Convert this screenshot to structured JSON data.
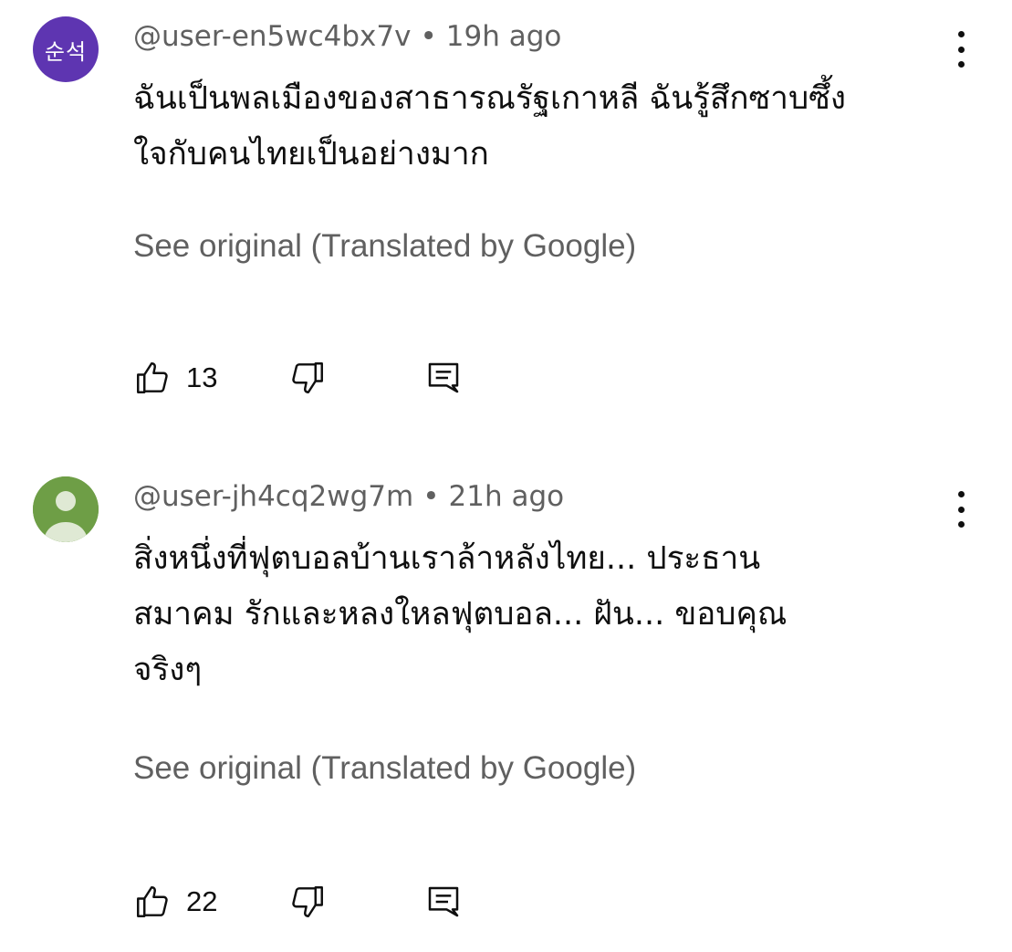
{
  "comments": [
    {
      "avatar_text": "순석",
      "avatar_color": "#5e35b1",
      "handle": "@user-en5wc4bx7v",
      "separator": "•",
      "time": "19h ago",
      "text_lines": [
        "ฉันเป็นพลเมืองของสาธารณรัฐเกาหลี ฉันรู้สึกซาบซึ้ง",
        "ใจกับคนไทยเป็นอย่างมาก"
      ],
      "see_original": "See original (Translated by Google)",
      "likes": "13",
      "icons": [
        "thumbs-up-icon",
        "thumbs-down-icon",
        "reply-icon",
        "more-vert-icon"
      ]
    },
    {
      "avatar_text": "",
      "avatar_color": "#6e9e46",
      "handle": "@user-jh4cq2wg7m",
      "separator": "•",
      "time": "21h ago",
      "text_lines": [
        "สิ่งหนึ่งที่ฟุตบอลบ้านเราล้าหลังไทย... ประธาน",
        "สมาคม รักและหลงใหลฟุตบอล... ฝัน... ขอบคุณ",
        "จริงๆ"
      ],
      "see_original": "See original (Translated by Google)",
      "likes": "22",
      "icons": [
        "thumbs-up-icon",
        "thumbs-down-icon",
        "reply-icon",
        "more-vert-icon"
      ]
    }
  ]
}
